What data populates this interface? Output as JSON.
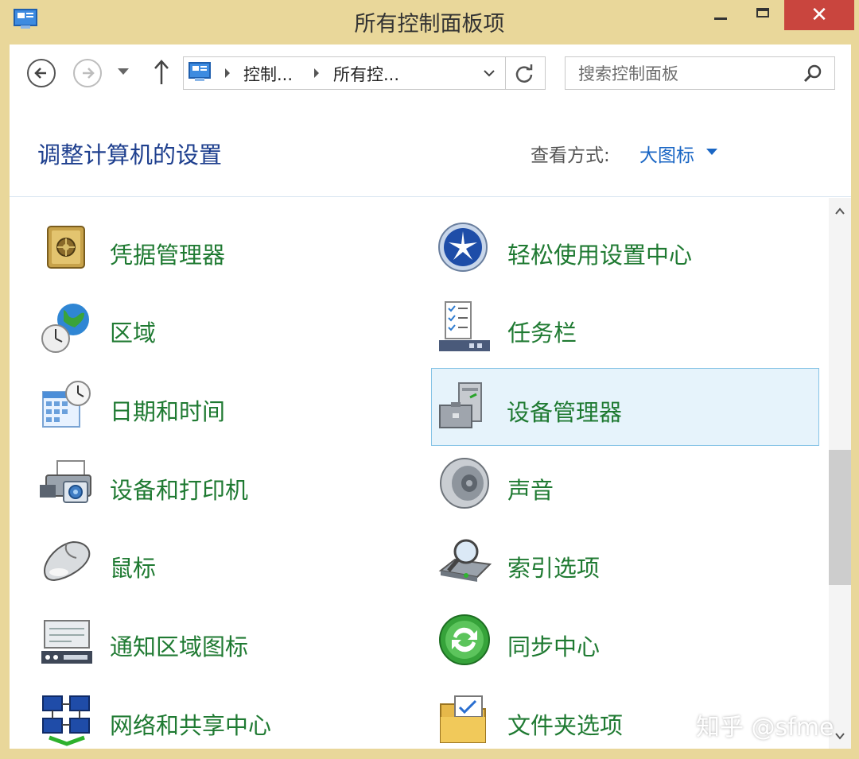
{
  "window": {
    "title": "所有控制面板项",
    "close_glyph": "✕"
  },
  "address_bar": {
    "crumbs": [
      "控制...",
      "所有控..."
    ]
  },
  "search": {
    "placeholder": "搜索控制面板"
  },
  "header": {
    "title": "调整计算机的设置",
    "view_label": "查看方式:",
    "view_value": "大图标"
  },
  "items": [
    {
      "label": "凭据管理器",
      "icon": "credential-manager-icon"
    },
    {
      "label": "轻松使用设置中心",
      "icon": "ease-of-access-icon"
    },
    {
      "label": "区域",
      "icon": "region-globe-icon"
    },
    {
      "label": "任务栏",
      "icon": "taskbar-icon"
    },
    {
      "label": "日期和时间",
      "icon": "date-time-icon"
    },
    {
      "label": "设备管理器",
      "icon": "device-manager-icon",
      "selected": true
    },
    {
      "label": "设备和打印机",
      "icon": "devices-printers-icon"
    },
    {
      "label": "声音",
      "icon": "sound-speaker-icon"
    },
    {
      "label": "鼠标",
      "icon": "mouse-icon"
    },
    {
      "label": "索引选项",
      "icon": "indexing-options-icon"
    },
    {
      "label": "通知区域图标",
      "icon": "notification-area-icon"
    },
    {
      "label": "同步中心",
      "icon": "sync-center-icon"
    },
    {
      "label": "网络和共享中心",
      "icon": "network-sharing-icon"
    },
    {
      "label": "文件夹选项",
      "icon": "folder-options-icon"
    }
  ],
  "watermark": "知乎 @sfme",
  "colors": {
    "title_text": "#1e3f8e",
    "item_text": "#1f7a32",
    "link": "#1a66c4",
    "close_button": "#c9453e",
    "frame": "#e9d79a",
    "selection": "#e6f3fb"
  }
}
